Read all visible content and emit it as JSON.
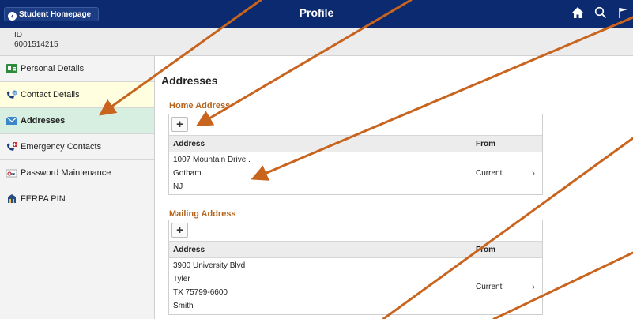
{
  "header": {
    "back_label": "Student Homepage",
    "title": "Profile",
    "icons": [
      "home-icon",
      "search-icon",
      "flag-icon"
    ]
  },
  "student": {
    "id_label": "ID",
    "id_value": "6001514215"
  },
  "sidebar": {
    "items": [
      {
        "label": "Personal Details",
        "icon": "id-card-icon",
        "state": "normal"
      },
      {
        "label": "Contact Details",
        "icon": "phone-email-icon",
        "state": "highlighted"
      },
      {
        "label": "Addresses",
        "icon": "envelope-icon",
        "state": "selected"
      },
      {
        "label": "Emergency Contacts",
        "icon": "emergency-phone-icon",
        "state": "normal"
      },
      {
        "label": "Password Maintenance",
        "icon": "key-icon",
        "state": "normal"
      },
      {
        "label": "FERPA PIN",
        "icon": "building-lock-icon",
        "state": "normal"
      }
    ]
  },
  "main": {
    "title": "Addresses",
    "home": {
      "title": "Home Address",
      "add_label": "+",
      "col_address": "Address",
      "col_from": "From",
      "lines": [
        "1007 Mountain Drive .",
        "Gotham",
        "NJ"
      ],
      "from": "Current",
      "chevron": "›"
    },
    "mailing": {
      "title": "Mailing Address",
      "add_label": "+",
      "col_address": "Address",
      "col_from": "From",
      "lines": [
        "3900 University Blvd",
        "Tyler",
        "TX 75799-6600",
        "Smith"
      ],
      "from": "Current",
      "chevron": "›"
    }
  },
  "colors": {
    "header_bg": "#0b2a6f",
    "section_title": "#b5651d",
    "selected_bg": "#d6efe1",
    "highlight_bg": "#ffffe0",
    "annotation_arrow": "#c8641e"
  }
}
